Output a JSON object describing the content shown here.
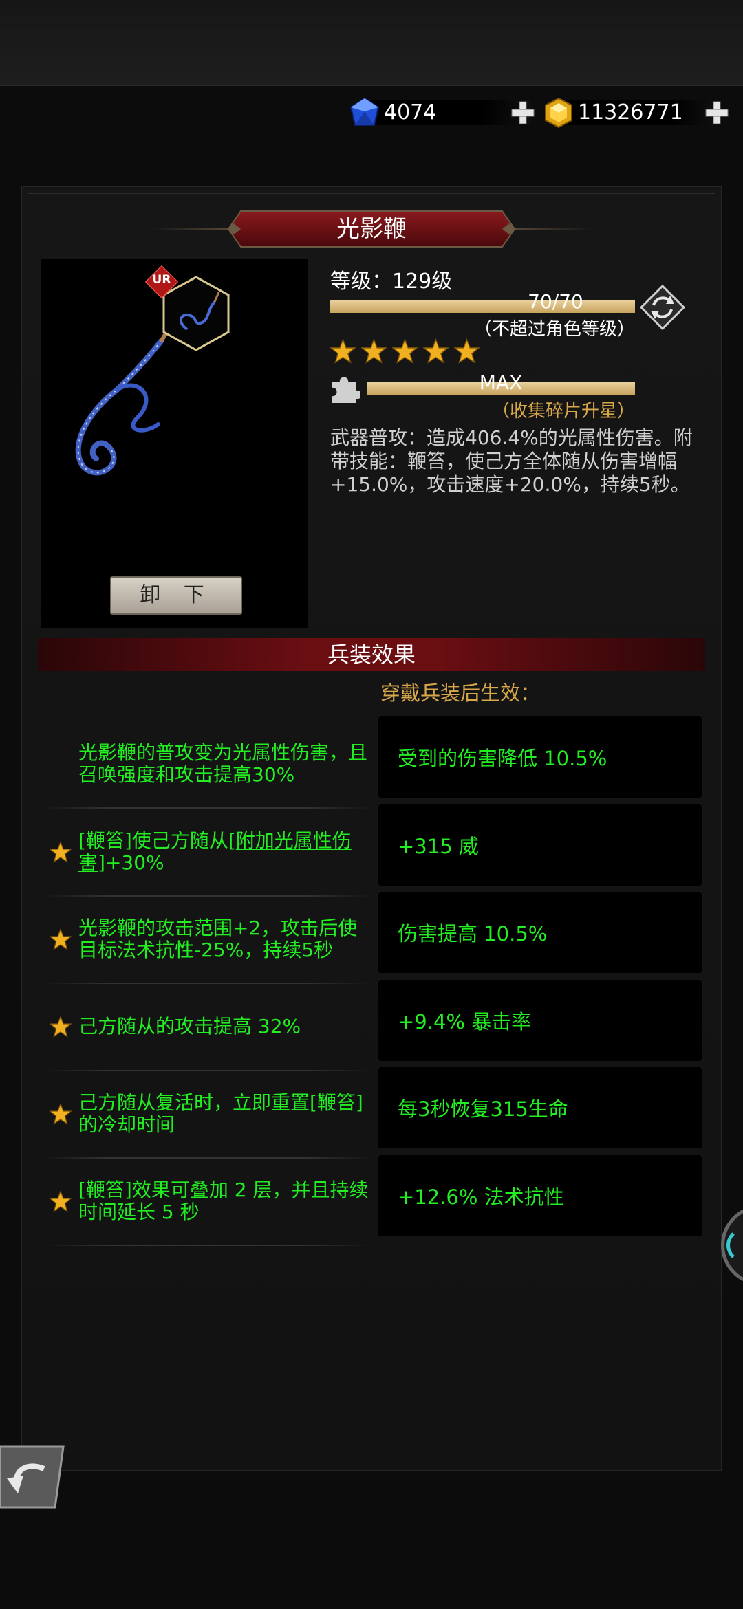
{
  "currency": {
    "gems": {
      "icon": "blue-gem-icon",
      "value": "4074"
    },
    "gold": {
      "icon": "gold-gem-icon",
      "value": "11326771"
    }
  },
  "weapon": {
    "name": "光影鞭",
    "rarity_badge": "UR",
    "unequip_label": "卸 下",
    "level_text": "等级：129级",
    "level_progress": "70/70",
    "level_note": "（不超过角色等级）",
    "level_fill": 1.0,
    "stars": 5,
    "star_progress": "MAX",
    "star_note": "（收集碎片升星）",
    "star_fill": 1.0,
    "description": "武器普攻：造成406.4%的光属性伤害。附带技能：鞭笞，使己方全体随从伤害增幅+15.0%，攻击速度+20.0%，持续5秒。"
  },
  "effects": {
    "title": "兵装效果",
    "after_equip": "穿戴兵装后生效：",
    "left_rows": [
      {
        "star": false,
        "text": "光影鞭的普攻变为光属性伤害，且召唤强度和攻击提高30%"
      },
      {
        "star": true,
        "text_before": "[鞭笞]使己方随从[",
        "link": "附加光属性伤害",
        "text_after": "]+30%"
      },
      {
        "star": true,
        "text": "光影鞭的攻击范围+2，攻击后使目标法术抗性-25%，持续5秒"
      },
      {
        "star": true,
        "text": "己方随从的攻击提高 32%"
      },
      {
        "star": true,
        "text": "己方随从复活时，立即重置[鞭笞]的冷却时间"
      },
      {
        "star": true,
        "text": "[鞭笞]效果可叠加 2 层，并且持续时间延长 5 秒"
      }
    ],
    "right_rows": [
      "受到的伤害降低 10.5%",
      "+315 威",
      "伤害提高 10.5%",
      "+9.4% 暴击率",
      "每3秒恢复315生命",
      "+12.6% 法术抗性"
    ]
  },
  "colors": {
    "effect_green": "#22ee22",
    "gold_text": "#d8a84a",
    "banner_red": "#6a0e12"
  }
}
